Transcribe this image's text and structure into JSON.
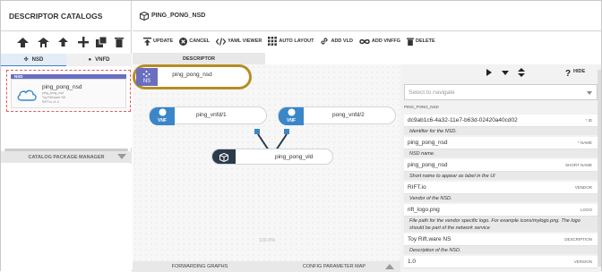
{
  "left": {
    "title": "DESCRIPTOR CATALOGS",
    "tabs": [
      {
        "label": "NSD"
      },
      {
        "label": "VNFD"
      }
    ],
    "card": {
      "type_badge": "NSD",
      "name": "ping_pong_nsd",
      "sub1": "ping_pong_nsd",
      "sub2": "Toy Rift.ware NS",
      "sub3": "RIFT.io v1.0"
    },
    "package_manager": "CATALOG PACKAGE MANAGER"
  },
  "main": {
    "title": "PING_PONG_NSD",
    "toolbar": [
      {
        "label": "UPDATE",
        "icon": "update-icon"
      },
      {
        "label": "CANCEL",
        "icon": "cancel-icon"
      },
      {
        "label": "YAML VIEWER",
        "icon": "code-icon"
      },
      {
        "label": "AUTO LAYOUT",
        "icon": "grid-icon"
      },
      {
        "label": "ADD VLD",
        "icon": "link-icon"
      },
      {
        "label": "ADD VNFFG",
        "icon": "infinity-icon"
      },
      {
        "label": "DELETE",
        "icon": "trash-icon"
      }
    ],
    "descriptor_tab": "DESCRIPTOR",
    "canvas": {
      "nsd_node": {
        "badge": "NS",
        "label": "ping_pong_nsd"
      },
      "vnf1": {
        "badge": "VNF",
        "label": "ping_vnfd/1"
      },
      "vnf2": {
        "badge": "VNF",
        "label": "pong_vnfd/2"
      },
      "vld": {
        "label": "ping_pong_vld"
      },
      "zoom": "100.0%"
    },
    "bottom_tabs": [
      "FORWARDING GRAPHS",
      "CONFIG PARAMETER MAP"
    ]
  },
  "right": {
    "hide_label": "HIDE",
    "navigate_placeholder": "Select to navigate",
    "section": "PING_PONG_NSD",
    "fields": [
      {
        "value": "dc9ab1c6-4a32-11e7-b63d-02420a40cd02",
        "key": "* ID",
        "desc": "Identifier for the NSD."
      },
      {
        "value": "ping_pong_nsd",
        "key": "* NAME",
        "desc": "NSD name."
      },
      {
        "value": "ping_pong_nsd",
        "key": "SHORT NAME",
        "desc": "Short name to appear as label in the UI"
      },
      {
        "value": "RIFT.io",
        "key": "VENDOR",
        "desc": "Vendor of the NSD."
      },
      {
        "value": "rift_logo.png",
        "key": "LOGO",
        "desc": "File path for the vendor specific logo. For example icons/mylogo.png. The logo should be part of the network service"
      },
      {
        "value": "Toy Rift.ware NS",
        "key": "DESCRIPTION",
        "desc": "Description of the NSD."
      },
      {
        "value": "1.0",
        "key": "VERSION",
        "desc": ""
      }
    ]
  },
  "colors": {
    "nsd_purple": "#6a6ec0",
    "vnf_blue": "#3a86c8",
    "vld_dark": "#2d3a4a",
    "highlight_gold": "#b58e23"
  }
}
